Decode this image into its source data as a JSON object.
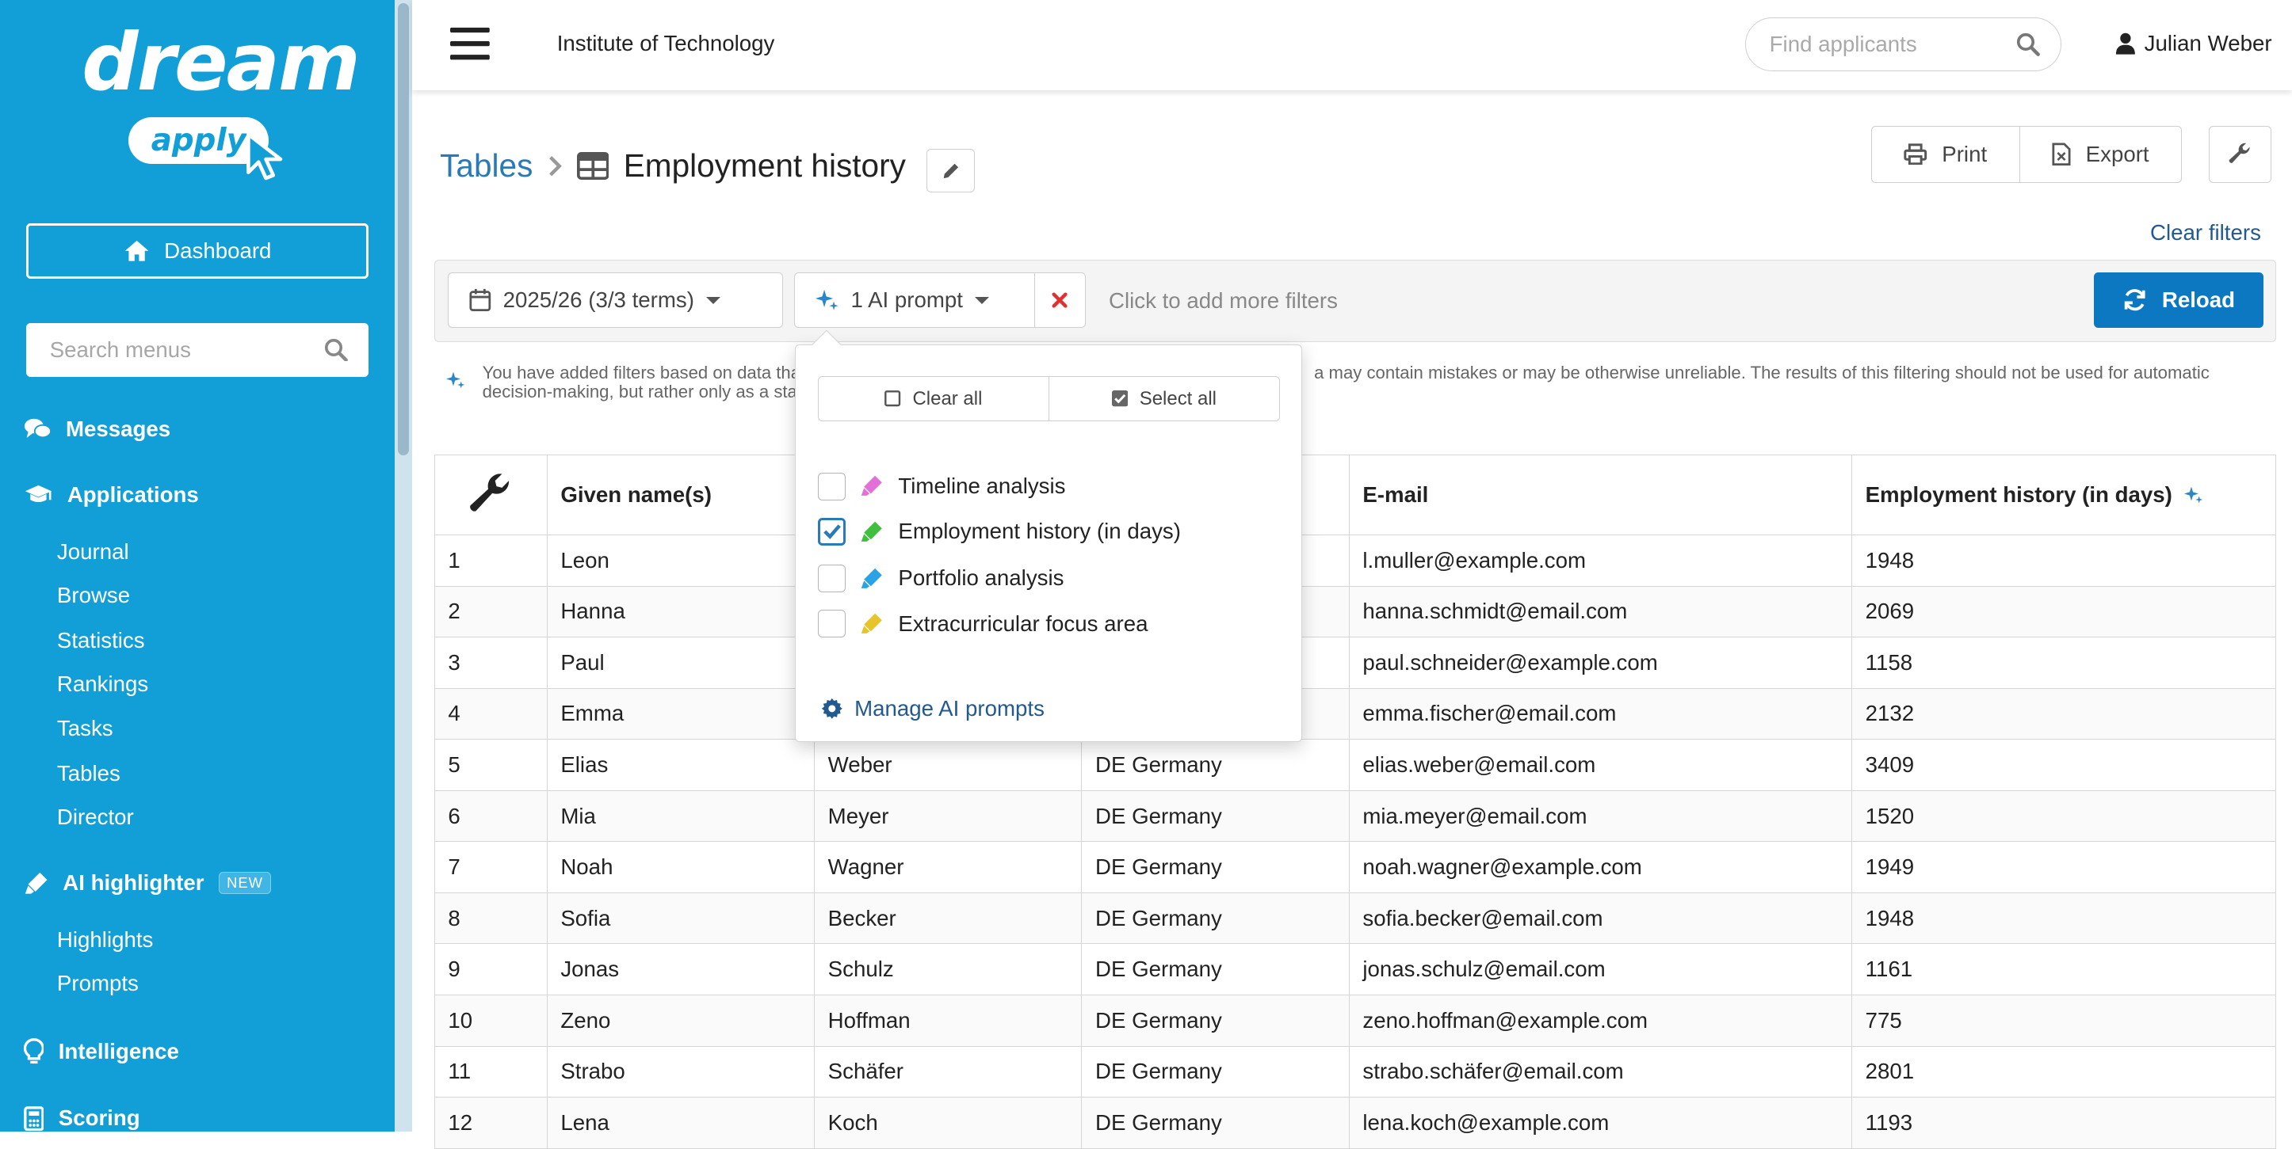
{
  "sidebar": {
    "logo_word": "dream",
    "logo_sub": "apply",
    "dashboard_label": "Dashboard",
    "search_placeholder": "Search menus",
    "messages": "Messages",
    "applications": "Applications",
    "app_items": [
      "Journal",
      "Browse",
      "Statistics",
      "Rankings",
      "Tasks",
      "Tables",
      "Director"
    ],
    "ai_highlighter": "AI highlighter",
    "ai_badge": "NEW",
    "ai_items": [
      "Highlights",
      "Prompts"
    ],
    "intelligence": "Intelligence",
    "scoring": "Scoring"
  },
  "topbar": {
    "institution": "Institute of Technology",
    "search_placeholder": "Find applicants",
    "user": "Julian Weber"
  },
  "breadcrumb": {
    "parent": "Tables",
    "title": "Employment history"
  },
  "toolbar": {
    "print": "Print",
    "export": "Export",
    "clear_filters": "Clear filters"
  },
  "filters": {
    "term": "2025/26 (3/3 terms)",
    "ai_prompt": "1 AI prompt",
    "add_more": "Click to add more filters",
    "reload": "Reload"
  },
  "notice": {
    "part1": "You have added filters based on data tha",
    "part2": "decision-making, but rather only as a sta",
    "part3": "a may contain mistakes or may be otherwise unreliable. The results of this filtering should not be used for automatic"
  },
  "dropdown": {
    "clear_all": "Clear all",
    "select_all": "Select all",
    "options": [
      {
        "label": "Timeline analysis",
        "checked": false,
        "color": "#e36fd8"
      },
      {
        "label": "Employment history (in days)",
        "checked": true,
        "color": "#3fbf3f"
      },
      {
        "label": "Portfolio analysis",
        "checked": false,
        "color": "#2aa3e6"
      },
      {
        "label": "Extracurricular focus area",
        "checked": false,
        "color": "#e6c42a"
      }
    ],
    "manage": "Manage AI prompts"
  },
  "table": {
    "headers": [
      "",
      "Given name(s)",
      "",
      "",
      "E-mail",
      "Employment history (in days)"
    ],
    "rows": [
      [
        "1",
        "Leon",
        "",
        "",
        "l.muller@example.com",
        "1948"
      ],
      [
        "2",
        "Hanna",
        "",
        "",
        "hanna.schmidt@email.com",
        "2069"
      ],
      [
        "3",
        "Paul",
        "",
        "",
        "paul.schneider@example.com",
        "1158"
      ],
      [
        "4",
        "Emma",
        "",
        "",
        "emma.fischer@email.com",
        "2132"
      ],
      [
        "5",
        "Elias",
        "Weber",
        "DE Germany",
        "elias.weber@email.com",
        "3409"
      ],
      [
        "6",
        "Mia",
        "Meyer",
        "DE Germany",
        "mia.meyer@email.com",
        "1520"
      ],
      [
        "7",
        "Noah",
        "Wagner",
        "DE Germany",
        "noah.wagner@example.com",
        "1949"
      ],
      [
        "8",
        "Sofia",
        "Becker",
        "DE Germany",
        "sofia.becker@email.com",
        "1948"
      ],
      [
        "9",
        "Jonas",
        "Schulz",
        "DE Germany",
        "jonas.schulz@email.com",
        "1161"
      ],
      [
        "10",
        "Zeno",
        "Hoffman",
        "DE Germany",
        "zeno.hoffman@example.com",
        "775"
      ],
      [
        "11",
        "Strabo",
        "Schäfer",
        "DE Germany",
        "strabo.schäfer@email.com",
        "2801"
      ],
      [
        "12",
        "Lena",
        "Koch",
        "DE Germany",
        "lena.koch@example.com",
        "1193"
      ]
    ]
  },
  "colors": {
    "sidebar": "#129fd8",
    "link": "#2a7ab8",
    "reload": "#0d78c2",
    "danger": "#e03131"
  }
}
